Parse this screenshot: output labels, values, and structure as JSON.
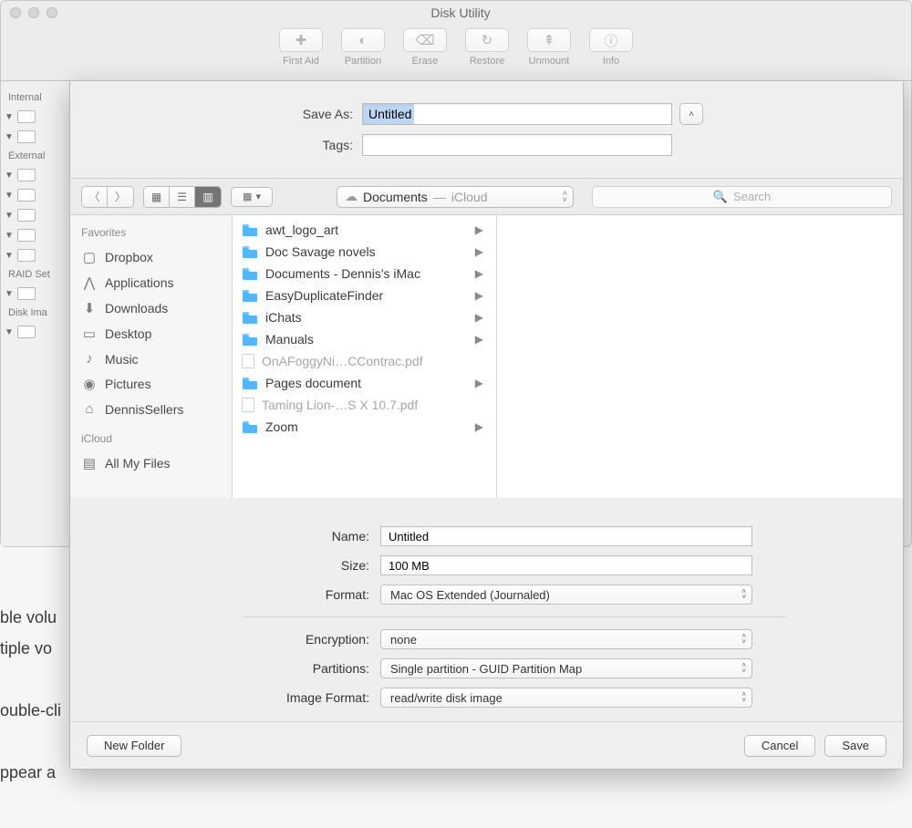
{
  "bg_window": {
    "title": "Disk Utility",
    "toolbar": [
      {
        "label": "First Aid",
        "glyph": "✚"
      },
      {
        "label": "Partition",
        "glyph": "◐"
      },
      {
        "label": "Erase",
        "glyph": "⌫"
      },
      {
        "label": "Restore",
        "glyph": "↻"
      },
      {
        "label": "Unmount",
        "glyph": "⇞"
      },
      {
        "label": "Info",
        "glyph": "ⓘ"
      }
    ],
    "sidebar": {
      "sections": [
        {
          "title": "Internal"
        },
        {
          "title": "External"
        },
        {
          "title": "RAID Set"
        },
        {
          "title": "Disk Ima"
        }
      ]
    }
  },
  "bg_snippets": [
    "ble volu",
    "tiple vo",
    "",
    "ouble-cli",
    "",
    "ppear a"
  ],
  "sheet": {
    "save_as_label": "Save As:",
    "save_as_value": "Untitled",
    "tags_label": "Tags:",
    "tags_value": "",
    "expand_glyph": "˄",
    "browser": {
      "path_folder": "Documents",
      "path_location": "iCloud",
      "search_placeholder": "Search",
      "sidebar": {
        "favorites_header": "Favorites",
        "favorites": [
          {
            "label": "Dropbox",
            "icon": "folder"
          },
          {
            "label": "Applications",
            "icon": "apps"
          },
          {
            "label": "Downloads",
            "icon": "downloads"
          },
          {
            "label": "Desktop",
            "icon": "desktop"
          },
          {
            "label": "Music",
            "icon": "music"
          },
          {
            "label": "Pictures",
            "icon": "pictures"
          },
          {
            "label": "DennisSellers",
            "icon": "home"
          }
        ],
        "icloud_header": "iCloud",
        "icloud": [
          {
            "label": "All My Files",
            "icon": "allfiles"
          }
        ]
      },
      "files": [
        {
          "name": "awt_logo_art",
          "type": "folder"
        },
        {
          "name": "Doc Savage novels",
          "type": "folder"
        },
        {
          "name": "Documents - Dennis's iMac",
          "type": "folder"
        },
        {
          "name": "EasyDuplicateFinder",
          "type": "folder"
        },
        {
          "name": "iChats",
          "type": "folder"
        },
        {
          "name": "Manuals",
          "type": "folder"
        },
        {
          "name": "OnAFoggyNi…CContrac.pdf",
          "type": "doc",
          "dim": true
        },
        {
          "name": "Pages document",
          "type": "folder"
        },
        {
          "name": "Taming Lion-…S X 10.7.pdf",
          "type": "doc",
          "dim": true
        },
        {
          "name": "Zoom",
          "type": "folder"
        }
      ]
    },
    "form": {
      "name_label": "Name:",
      "name_value": "Untitled",
      "size_label": "Size:",
      "size_value": "100 MB",
      "format_label": "Format:",
      "format_value": "Mac OS Extended (Journaled)",
      "encryption_label": "Encryption:",
      "encryption_value": "none",
      "partitions_label": "Partitions:",
      "partitions_value": "Single partition - GUID Partition Map",
      "image_format_label": "Image Format:",
      "image_format_value": "read/write disk image"
    },
    "buttons": {
      "new_folder": "New Folder",
      "cancel": "Cancel",
      "save": "Save"
    }
  }
}
